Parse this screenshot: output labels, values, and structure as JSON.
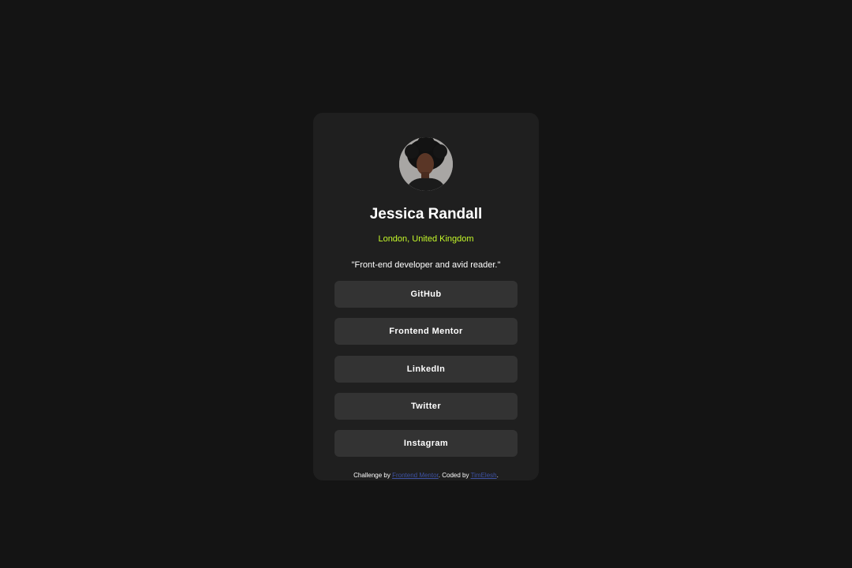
{
  "profile": {
    "name": "Jessica Randall",
    "location": "London, United Kingdom",
    "bio": "\"Front-end developer and avid reader.\""
  },
  "links": [
    {
      "label": "GitHub"
    },
    {
      "label": "Frontend Mentor"
    },
    {
      "label": "LinkedIn"
    },
    {
      "label": "Twitter"
    },
    {
      "label": "Instagram"
    }
  ],
  "attribution": {
    "prefix": "Challenge by ",
    "challenge_link": "Frontend Mentor",
    "middle": ". Coded by ",
    "author_link": "TimElesh",
    "suffix": "."
  },
  "colors": {
    "page_bg": "#141414",
    "card_bg": "#1f1f1f",
    "button_bg": "#333333",
    "accent_green": "#c4f82a",
    "link_blue": "#3e52a3"
  }
}
